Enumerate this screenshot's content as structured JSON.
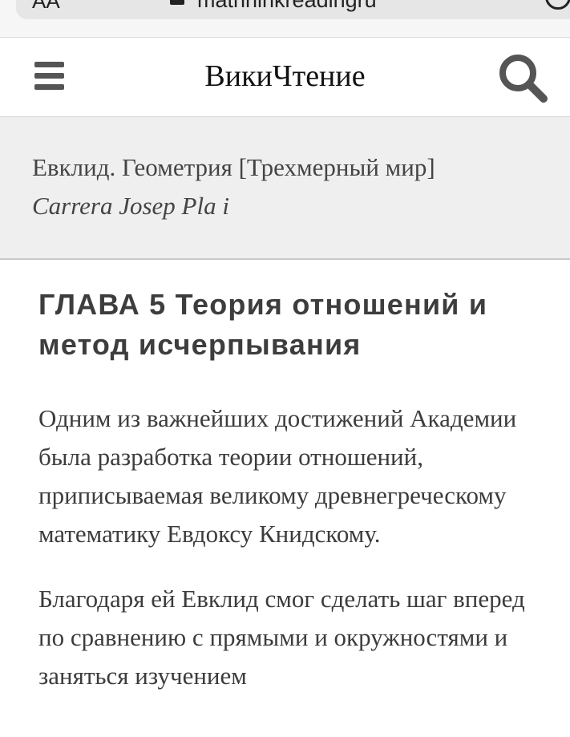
{
  "browser": {
    "text_size_label": "AA",
    "url": "mathhihkreadingru"
  },
  "header": {
    "brand": "ВикиЧтение",
    "menu_icon": "hamburger-icon",
    "search_icon": "search-icon"
  },
  "book": {
    "title": "Евклид. Геометрия [Трехмерный мир]",
    "author": "Carrera Josep Pla i"
  },
  "article": {
    "chapter_title": "ГЛАВА 5 Теория отношений и метод исчерпывания",
    "paragraphs": [
      "Одним из важнейших достижений Академии была разработка теории отношений, приписываемая великому древнегреческому математику Евдоксу Книдскому.",
      "Благодаря ей Евклид смог сделать шаг вперед по сравнению с прямыми и окружностями и заняться изучением"
    ]
  },
  "colors": {
    "header_bg": "#ffffff",
    "info_bg": "#efefef",
    "text": "#3c3c3c",
    "icon": "#555555"
  }
}
